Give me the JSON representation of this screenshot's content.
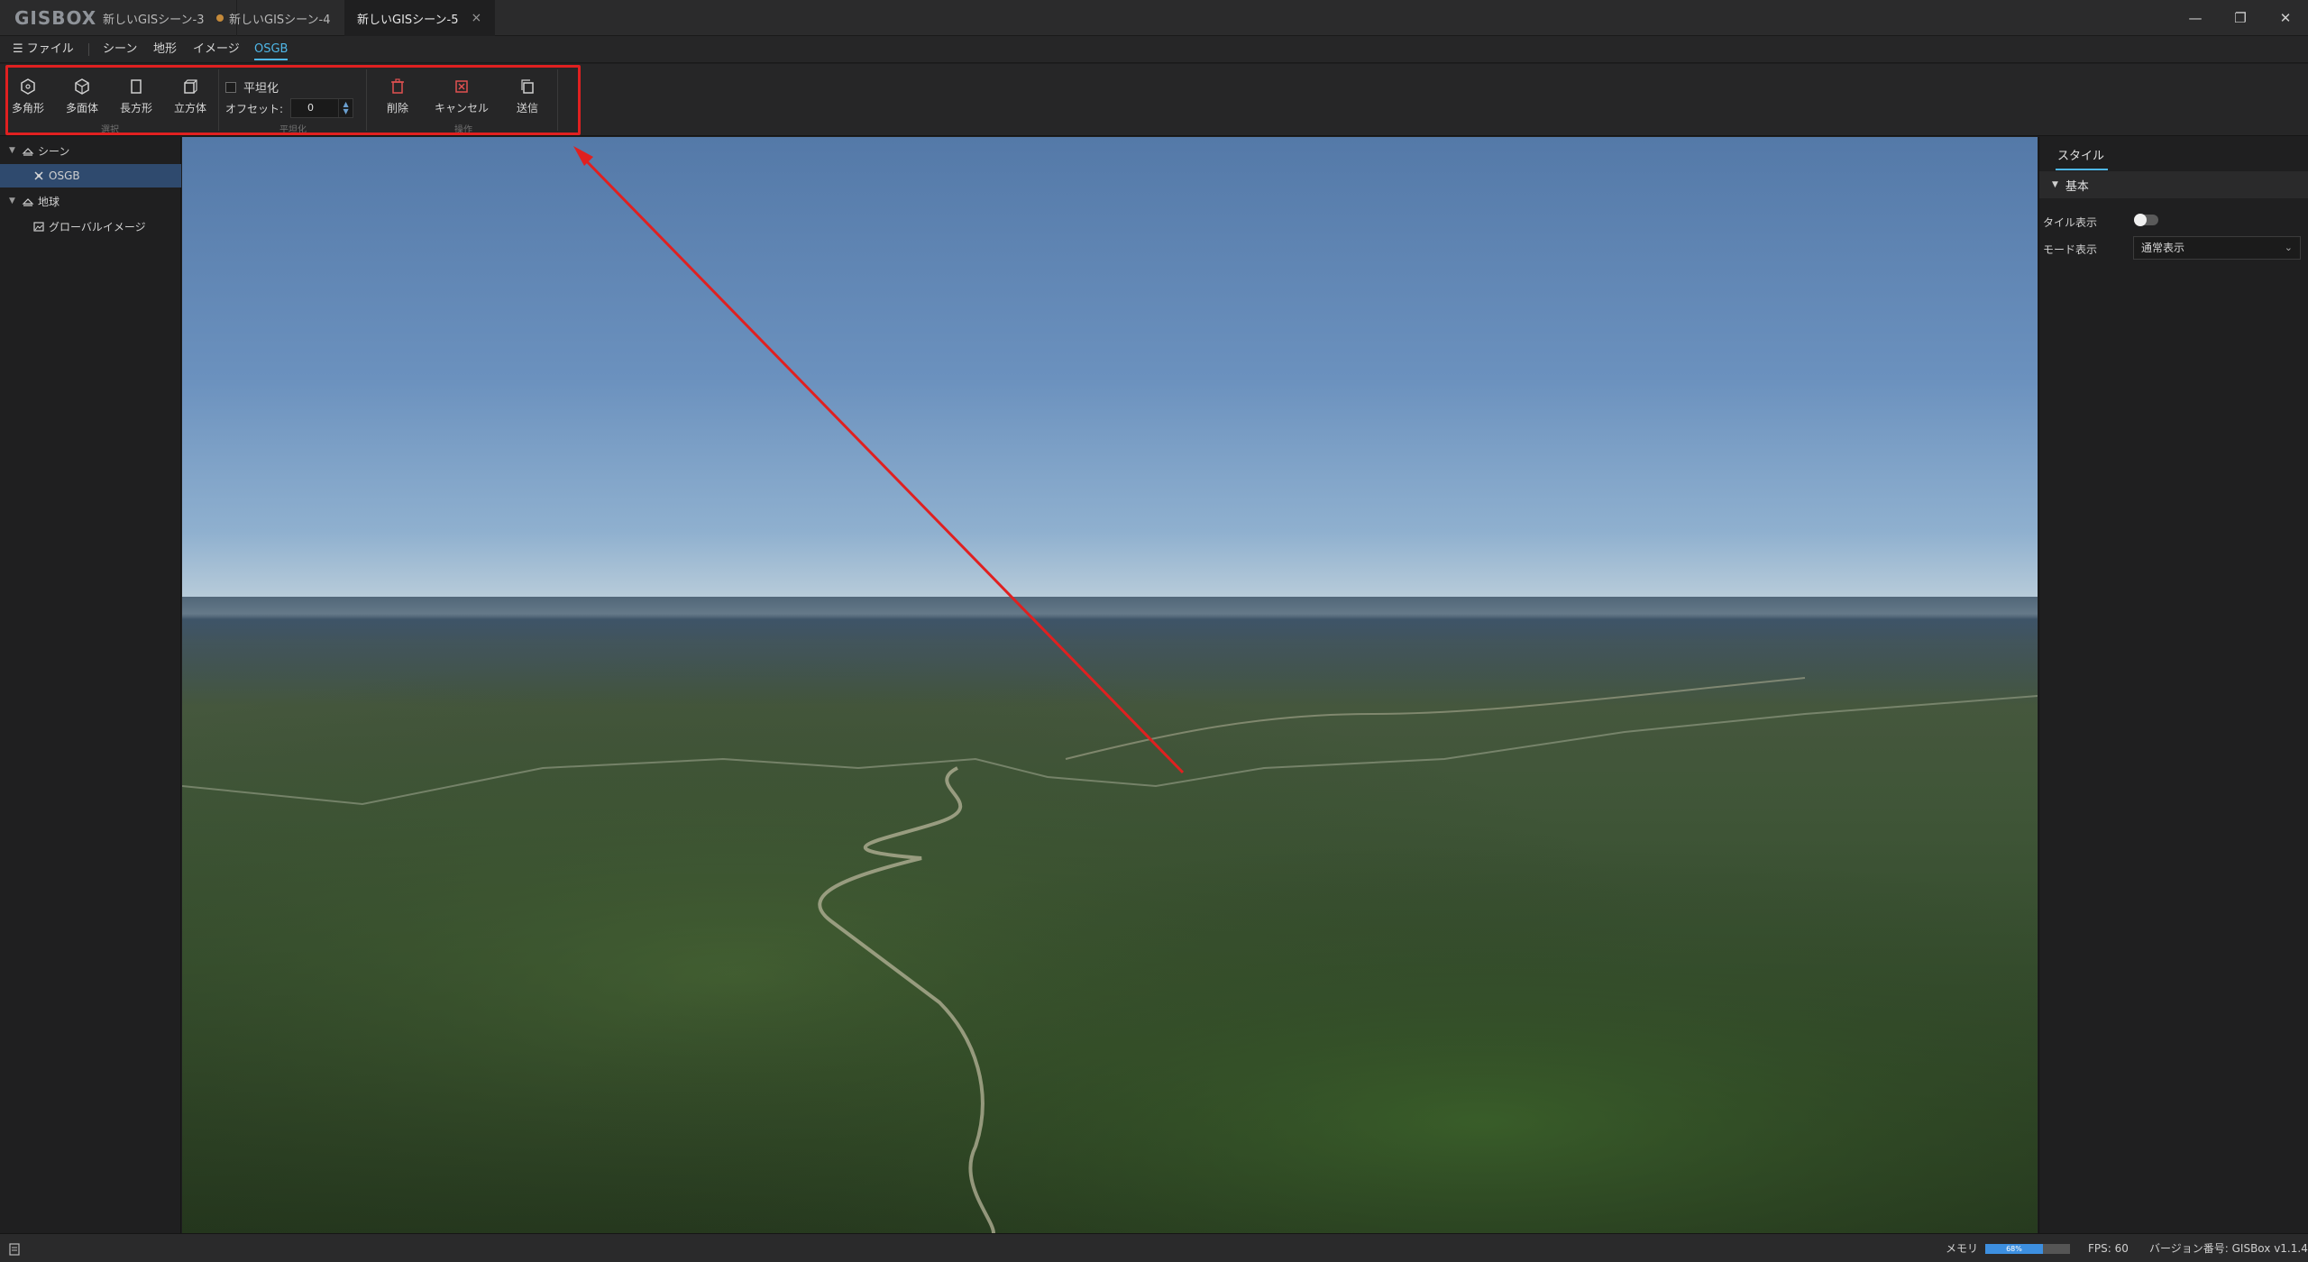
{
  "app": {
    "logo": "GISBOX"
  },
  "tabs": [
    {
      "label": "新しいGISシーン-3",
      "modified": true
    },
    {
      "label": "新しいGISシーン-4",
      "close": "×"
    },
    {
      "label": "新しいGISシーン-5",
      "close": "×",
      "active": true
    }
  ],
  "window_controls": {
    "minimize": "—",
    "restore": "❐",
    "close": "✕"
  },
  "menubar": {
    "file": "ファイル",
    "items": [
      "シーン",
      "地形",
      "イメージ",
      "OSGB"
    ],
    "active": "OSGB"
  },
  "ribbon": {
    "select_group": {
      "label": "選択",
      "buttons": [
        "多角形",
        "多面体",
        "長方形",
        "立方体"
      ]
    },
    "flatten_group": {
      "label": "平坦化",
      "checkbox_label": "平坦化",
      "checked": false,
      "offset_label": "オフセット:",
      "offset_value": "0"
    },
    "operation_group": {
      "label": "操作",
      "buttons": [
        "削除",
        "キャンセル",
        "送信"
      ]
    }
  },
  "tree": {
    "scene": "シーン",
    "scene_child": "OSGB",
    "earth": "地球",
    "earth_child": "グローバルイメージ"
  },
  "right_panel": {
    "tab": "スタイル",
    "section": "基本",
    "tile_display_label": "タイル表示",
    "tile_display_on": false,
    "mode_display_label": "モード表示",
    "mode_display_value": "通常表示"
  },
  "status": {
    "memory_label": "メモリ",
    "memory_percent": "68%",
    "memory_fraction": 0.68,
    "fps": "FPS: 60",
    "version": "バージョン番号: GISBox v1.1.4"
  },
  "colors": {
    "accent": "#4fb7e8",
    "highlight": "#e02020",
    "selection": "#2f4a6e"
  }
}
